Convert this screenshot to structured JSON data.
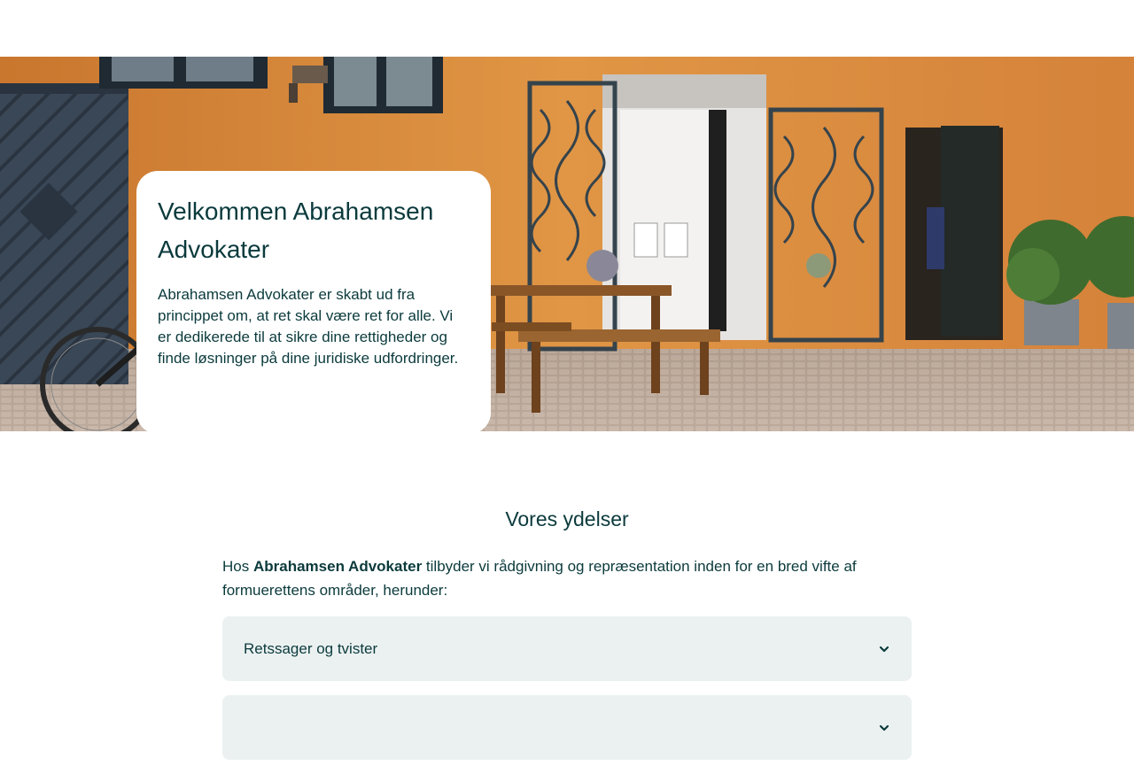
{
  "hero": {
    "title": "Velkommen Abrahamsen Advokater",
    "text": "Abrahamsen Advokater er skabt ud fra princippet om, at ret skal være ret for alle. Vi er dedikerede til at sikre dine rettigheder og finde løsninger på dine juridiske udfordringer."
  },
  "services": {
    "title": "Vores ydelser",
    "intro_prefix": "Hos ",
    "intro_brand": "Abrahamsen Advokater",
    "intro_suffix": " tilbyder vi rådgivning og repræsentation inden for en bred vifte af formuerettens områder, herunder:",
    "items": [
      {
        "label": "Retssager og tvister",
        "icon": "chevron-down-icon"
      },
      {
        "label": "",
        "icon": "chevron-down-icon"
      }
    ]
  },
  "colors": {
    "text": "#0b3a3c",
    "accordion_bg": "#ebf1f1",
    "wall": "#d98a3a"
  }
}
